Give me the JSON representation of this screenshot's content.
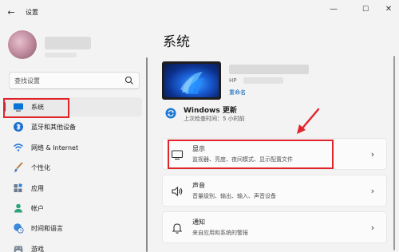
{
  "window": {
    "title": "设置",
    "back_icon": "back-arrow-icon",
    "controls": {
      "minimize": "—",
      "maximize": "☐",
      "close": "✕"
    }
  },
  "sidebar": {
    "search": {
      "placeholder": "查找设置"
    },
    "items": [
      {
        "label": "系统",
        "icon": "monitor-icon",
        "active": true
      },
      {
        "label": "蓝牙和其他设备",
        "icon": "bluetooth-icon"
      },
      {
        "label": "网络 & Internet",
        "icon": "wifi-icon"
      },
      {
        "label": "个性化",
        "icon": "brush-icon"
      },
      {
        "label": "应用",
        "icon": "apps-icon"
      },
      {
        "label": "帐户",
        "icon": "account-icon"
      },
      {
        "label": "时间和语言",
        "icon": "globe-clock-icon"
      },
      {
        "label": "游戏",
        "icon": "game-icon"
      }
    ]
  },
  "main": {
    "title": "系统",
    "device": {
      "model_prefix": "HP",
      "rename": "重命名"
    },
    "windows_update": {
      "title": "Windows 更新",
      "subtitle": "上次检查时间：5 小时前"
    },
    "cards": [
      {
        "title": "显示",
        "subtitle": "监视器、亮度、夜间模式、显示配置文件",
        "icon": "display-icon"
      },
      {
        "title": "声音",
        "subtitle": "音量级别、输出、输入、声音设备",
        "icon": "speaker-icon"
      },
      {
        "title": "通知",
        "subtitle": "来自应用和系统的警报",
        "icon": "bell-icon"
      }
    ]
  },
  "colors": {
    "accent": "#005fb8",
    "annotation_red": "#e0242a"
  }
}
